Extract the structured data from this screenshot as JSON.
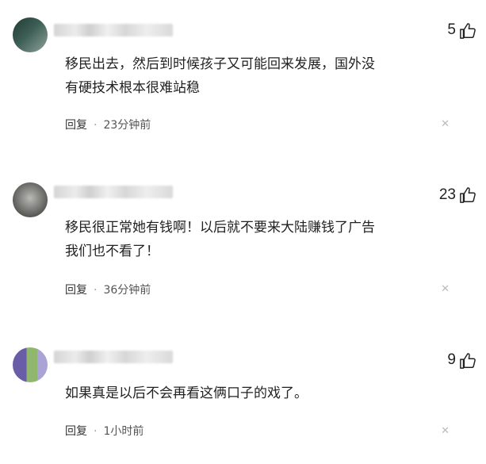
{
  "comments": [
    {
      "likes": "5",
      "text_line1": "移民出去，然后到时候孩子又可能回来发展，国外没",
      "text_line2": "有硬技术根本很难站稳",
      "reply_label": "回复",
      "time": "23分钟前"
    },
    {
      "likes": "23",
      "text_line1": "移民很正常她有钱啊！以后就不要来大陆赚钱了广告",
      "text_line2": "我们也不看了！",
      "reply_label": "回复",
      "time": "36分钟前"
    },
    {
      "likes": "9",
      "text_line1": "如果真是以后不会再看这俩口子的戏了。",
      "reply_label": "回复",
      "time": "1小时前"
    }
  ],
  "icons": {
    "like": "thumbs-up-icon",
    "close": "close-icon"
  },
  "colors": {
    "text": "#222222",
    "meta": "#555555",
    "close": "#bbbbbb"
  }
}
